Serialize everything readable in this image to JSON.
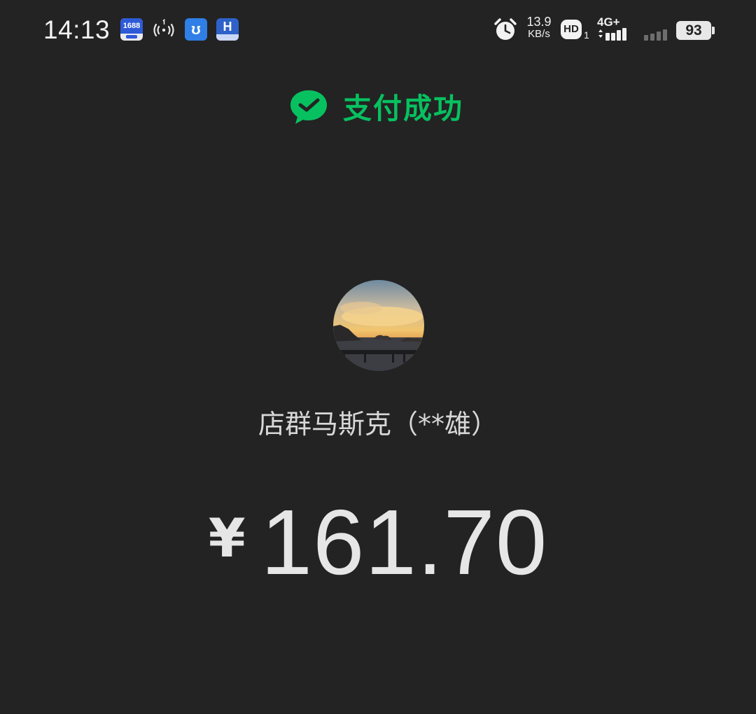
{
  "status_bar": {
    "time": "14:13",
    "apps": {
      "app1_label": "1688"
    },
    "speed": {
      "value": "13.9",
      "unit": "KB/s"
    },
    "hd": {
      "label": "HD",
      "sub": "1"
    },
    "network": "4G+",
    "battery": "93"
  },
  "payment": {
    "status_text": "支付成功",
    "merchant_name": "店群马斯克（**雄）",
    "currency_symbol": "¥",
    "amount": "161.70",
    "accent_color": "#07c160"
  }
}
